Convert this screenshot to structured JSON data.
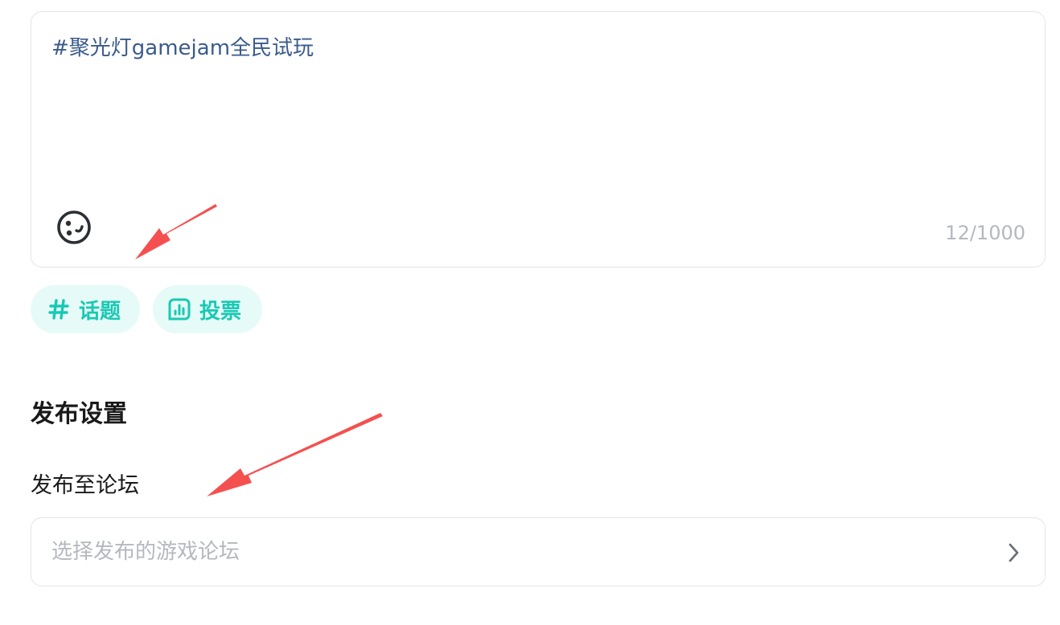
{
  "composer": {
    "text": "#聚光灯gamejam全民试玩",
    "char_count": "12/1000",
    "emoji_icon": "emoji-face-icon"
  },
  "toolbar": {
    "topic": {
      "label": "话题",
      "icon": "hash-icon"
    },
    "vote": {
      "label": "投票",
      "icon": "vote-chart-icon"
    }
  },
  "publish_settings": {
    "title": "发布设置",
    "forum_label": "发布至论坛",
    "forum_placeholder": "选择发布的游戏论坛",
    "chevron_icon": "chevron-right-icon"
  },
  "annotations": {
    "arrow_color": "#f55050"
  },
  "colors": {
    "accent": "#19c9b3",
    "chip_bg": "#e6fbf7",
    "topic_text": "#3b5b8c",
    "placeholder": "#b4b8bf",
    "border": "#e3e5e8"
  }
}
